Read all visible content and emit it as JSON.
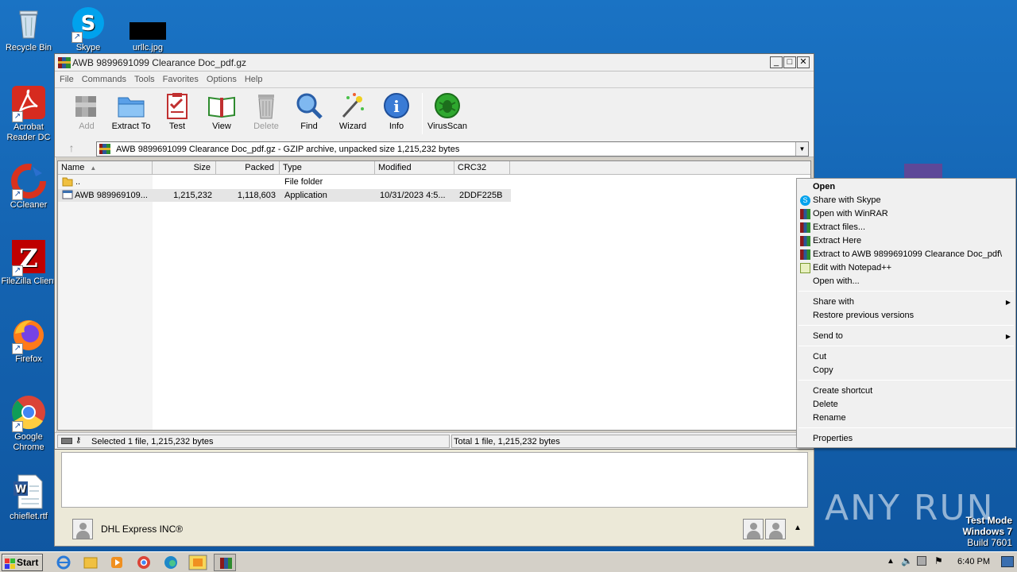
{
  "desktop": {
    "icons": [
      {
        "label": "Recycle Bin"
      },
      {
        "label": "Skype"
      },
      {
        "label": "urllc.jpg"
      },
      {
        "label": "Acrobat Reader DC"
      },
      {
        "label": "CCleaner"
      },
      {
        "label": "FileZilla Client"
      },
      {
        "label": "Firefox"
      },
      {
        "label": "Google Chrome"
      },
      {
        "label": "chieflet.rtf"
      }
    ]
  },
  "window": {
    "title": "AWB 9899691099 Clearance Doc_pdf.gz",
    "menu": [
      "File",
      "Commands",
      "Tools",
      "Favorites",
      "Options",
      "Help"
    ],
    "toolbar": [
      {
        "label": "Add",
        "icon": "add-icon",
        "disabled": true
      },
      {
        "label": "Extract To",
        "icon": "extract-to-icon"
      },
      {
        "label": "Test",
        "icon": "test-icon"
      },
      {
        "label": "View",
        "icon": "view-icon"
      },
      {
        "label": "Delete",
        "icon": "delete-icon",
        "disabled": true
      },
      {
        "label": "Find",
        "icon": "find-icon"
      },
      {
        "label": "Wizard",
        "icon": "wizard-icon"
      },
      {
        "label": "Info",
        "icon": "info-icon"
      },
      {
        "label": "VirusScan",
        "icon": "virusscan-icon"
      }
    ],
    "address": "AWB 9899691099 Clearance Doc_pdf.gz - GZIP archive, unpacked size 1,215,232 bytes",
    "columns": [
      "Name",
      "Size",
      "Packed",
      "Type",
      "Modified",
      "CRC32"
    ],
    "rows": [
      {
        "name": "..",
        "size": "",
        "packed": "",
        "type": "File folder",
        "modified": "",
        "crc": ""
      },
      {
        "name": "AWB 989969109...",
        "size": "1,215,232",
        "packed": "1,118,603",
        "type": "Application",
        "modified": "10/31/2023 4:5...",
        "crc": "2DDF225B"
      }
    ],
    "status_left": "Selected 1 file, 1,215,232 bytes",
    "status_right": "Total 1 file, 1,215,232 bytes"
  },
  "under_window": {
    "contact": "DHL Express INC®"
  },
  "context_menu": {
    "items": [
      {
        "label": "Open",
        "bold": true
      },
      {
        "label": "Share with Skype",
        "icon": "skype-icon"
      },
      {
        "label": "Open with WinRAR",
        "icon": "winrar-icon"
      },
      {
        "label": "Extract files...",
        "icon": "winrar-icon"
      },
      {
        "label": "Extract Here",
        "icon": "winrar-icon"
      },
      {
        "label": "Extract to AWB 9899691099 Clearance Doc_pdf\\",
        "icon": "winrar-icon"
      },
      {
        "label": "Edit with Notepad++",
        "icon": "notepadpp-icon"
      },
      {
        "label": "Open with..."
      },
      {
        "label": "Share with",
        "submenu": true
      },
      {
        "label": "Restore previous versions"
      },
      {
        "label": "Send to",
        "submenu": true
      },
      {
        "label": "Cut"
      },
      {
        "label": "Copy"
      },
      {
        "label": "Create shortcut"
      },
      {
        "label": "Delete"
      },
      {
        "label": "Rename"
      },
      {
        "label": "Properties"
      }
    ]
  },
  "taskbar": {
    "start_label": "Start",
    "clock": "6:40 PM"
  },
  "watermark": {
    "brand": "ANY RUN",
    "line1": "Test Mode",
    "line2": "Windows 7",
    "line3": "Build 7601"
  }
}
